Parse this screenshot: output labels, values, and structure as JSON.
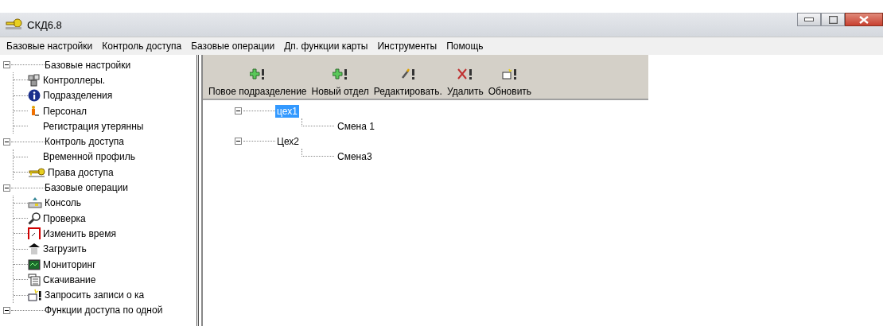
{
  "window": {
    "title": "СКД6.8"
  },
  "menu": [
    "Базовые настройки",
    "Контроль доступа",
    "Базовые операции",
    "Дп. функции карты",
    "Инструменты",
    "Помощь"
  ],
  "nav_tree": [
    {
      "label": "Базовые настройки",
      "expanded": true,
      "children": [
        {
          "label": "Контроллеры.",
          "kind": "controllers"
        },
        {
          "label": "Подразделения",
          "kind": "info"
        },
        {
          "label": "Персонал",
          "kind": "person"
        },
        {
          "label": "Регистрация утерянны",
          "kind": "plain"
        }
      ]
    },
    {
      "label": "Контроль доступа",
      "expanded": true,
      "children": [
        {
          "label": "Временной профиль",
          "kind": "plain"
        },
        {
          "label": "Права доступа",
          "kind": "key"
        }
      ]
    },
    {
      "label": "Базовые операции",
      "expanded": true,
      "children": [
        {
          "label": "Консоль",
          "kind": "console"
        },
        {
          "label": "Проверка",
          "kind": "wrench"
        },
        {
          "label": "Изменить время",
          "kind": "clock"
        },
        {
          "label": "Загрузить",
          "kind": "upload"
        },
        {
          "label": "Мониторинг",
          "kind": "monitor"
        },
        {
          "label": "Скачивание",
          "kind": "download"
        },
        {
          "label": "Запросить записи о ка",
          "kind": "request"
        }
      ]
    },
    {
      "label": "Функции доступа по одной",
      "expanded": true
    }
  ],
  "toolbar": [
    {
      "label": "Повое подразделение",
      "kind": "add"
    },
    {
      "label": "Новый отдел",
      "kind": "add"
    },
    {
      "label": "Редактировать.",
      "kind": "edit"
    },
    {
      "label": "Удалить",
      "kind": "delete"
    },
    {
      "label": "Обновить",
      "kind": "refresh"
    }
  ],
  "dept_tree": [
    {
      "label": "цех1",
      "expanded": true,
      "selected": true,
      "children": [
        {
          "label": "Смена 1",
          "selected": false
        }
      ]
    },
    {
      "label": "Цех2",
      "expanded": true,
      "selected": false,
      "children": [
        {
          "label": "Смена3",
          "selected": false
        }
      ]
    }
  ]
}
